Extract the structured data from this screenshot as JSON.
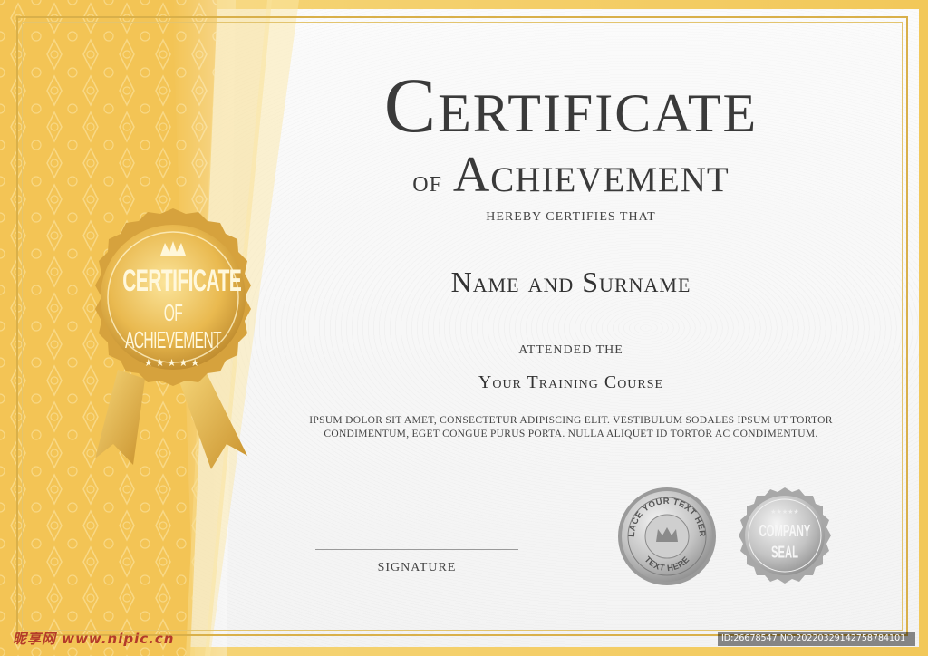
{
  "certificate": {
    "title_main": "Certificate",
    "title_of": "of",
    "title_sub": "Achievement",
    "hereby": "HEREBY CERTIFIES THAT",
    "recipient": "Name and Surname",
    "attended": "ATTENDED THE",
    "course": "Your Training Course",
    "body_line1": "ipsum dolor sit amet, consectetur adipiscing elit. Vestibulum sodales ipsum ut tortor",
    "body_line2": "condimentum, eget congue purus porta. Nulla aliquet id tortor ac condimentum.",
    "signature_label": "Signature"
  },
  "badge": {
    "line1": "CERTIFICATE",
    "line2": "OF ACHIEVEMENT",
    "stars": "★★★★★"
  },
  "seal_place": {
    "top_text": "PLACE YOUR TEXT HERE",
    "bottom_text": "TEXT HERE"
  },
  "seal_company": {
    "stars": "★★★★★",
    "line1": "COMPANY",
    "line2": "SEAL"
  },
  "watermark": {
    "left": "昵享网 www.nipic.cn",
    "right": "ID:26678547 NO:20220329142758784101"
  },
  "colors": {
    "gold": "#f2c85a",
    "gold_dark": "#c8922a",
    "text": "#3a3a3a",
    "silver": "#b8b8b8"
  }
}
